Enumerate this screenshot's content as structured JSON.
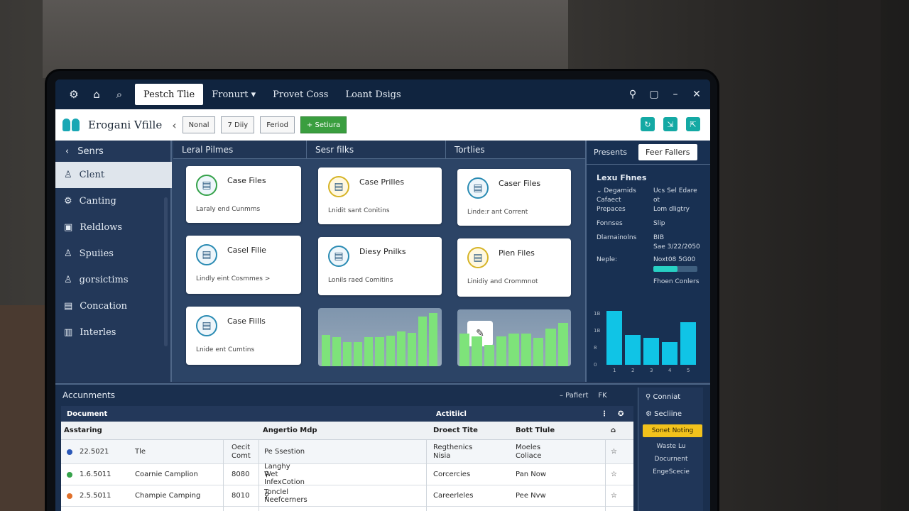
{
  "titlebar": {
    "tabs": [
      "Pestch Tlie",
      "Fronurt",
      "Provet Coss",
      "Loant Dsigs"
    ]
  },
  "header": {
    "app_name": "Erogani Vfille",
    "buttons": [
      "Nonal",
      "7 Diiy",
      "Feriod"
    ],
    "primary_button": "+ Setiura"
  },
  "sidebar": {
    "back_label": "Senrs",
    "items": [
      {
        "label": "Clent",
        "icon": "user-icon"
      },
      {
        "label": "Canting",
        "icon": "network-icon"
      },
      {
        "label": "Reldlows",
        "icon": "folder-icon"
      },
      {
        "label": "Spuiies",
        "icon": "person-icon"
      },
      {
        "label": "gorsictims",
        "icon": "person-icon"
      },
      {
        "label": "Concation",
        "icon": "building-icon"
      },
      {
        "label": "Interles",
        "icon": "document-icon"
      }
    ]
  },
  "main": {
    "columns": [
      "Leral Pilmes",
      "Sesr filks",
      "Tortlies"
    ],
    "cards": [
      {
        "title": "Case Files",
        "subtitle": "Laraly end Cunmms"
      },
      {
        "title": "Case Prilles",
        "subtitle": "Lnidit sant Conitins"
      },
      {
        "title": "Caser Files",
        "subtitle": "Linde:r ant Corrent"
      },
      {
        "title": "Casel Filie",
        "subtitle": "Lindly eint Cosmmes >"
      },
      {
        "title": "Diesy Pnilks",
        "subtitle": "Lonils raed Comitins"
      },
      {
        "title": "Pien Files",
        "subtitle": "Linidiy and Crommnot"
      },
      {
        "title": "Case Fiills",
        "subtitle": "Lnide ent Cumtins"
      }
    ],
    "chart_a": [
      0.56,
      0.52,
      0.44,
      0.44,
      0.52,
      0.52,
      0.55,
      0.63,
      0.6,
      0.9,
      0.96
    ],
    "chart_b": [
      0.6,
      0.55,
      0.4,
      0.55,
      0.6,
      0.6,
      0.52,
      0.7,
      0.8
    ]
  },
  "right_panel": {
    "tab_inactive": "Presents",
    "tab_active": "Feer Fallers",
    "title": "Lexu Fhnes",
    "rows": [
      {
        "key": "Degamids",
        "value": "Ucs Sel Edare"
      },
      {
        "key": "Cafaect",
        "value": "ot"
      },
      {
        "key": "Prepaces",
        "value": "Lom dligtry"
      },
      {
        "key": "Fonnses",
        "value": "Slip"
      },
      {
        "key": "Dlarnainolns",
        "value": "BIB"
      },
      {
        "key": "",
        "value": "Sae 3/22/2050"
      },
      {
        "key": "Neple:",
        "value": "Noxt08 5G00"
      }
    ],
    "progress": 0.55,
    "link": "Fhoen Conlers",
    "chart": {
      "type": "bar",
      "categories": [
        "1",
        "2",
        "3",
        "4",
        "5"
      ],
      "values": [
        0.95,
        0.53,
        0.47,
        0.4,
        0.75
      ],
      "y_ticks": [
        "1B",
        "1B",
        "8",
        "0"
      ]
    }
  },
  "documents": {
    "title": "Accunments",
    "controls": [
      "– Pafiert",
      "FK"
    ],
    "table_top": {
      "left": "Document",
      "mid": "Actitiicl"
    },
    "columns": [
      "Asstaring",
      "Angertio Mdp",
      "Droect Tite",
      "Bott Tlule"
    ],
    "rows": [
      {
        "dot": "#2a58b8",
        "date": "22.5021",
        "name": "Tle",
        "code": "Oecit Comt",
        "desc": "Pe Ssestion",
        "type": "Regthenics Nisia",
        "status": "Moeles Coliace"
      },
      {
        "dot": "#35a24a",
        "date": "1.6.5011",
        "name": "Coarnie Camplion",
        "code": "8080",
        "desc": "Langhy Wet InfexCotion",
        "type": "Corcercies",
        "status": "Pan Now"
      },
      {
        "dot": "#e0702a",
        "date": "2.5.5011",
        "name": "Champie Camping",
        "code": "8010",
        "desc": "Tonclel Neefcerners",
        "type": "Careerleles",
        "status": "Pee Nvw"
      }
    ],
    "side": {
      "contact": "Conniat",
      "settings": "Secliine",
      "button": "Sonet Noting",
      "lines": [
        "Waste Lu",
        "Docurnent",
        "EngeScecie"
      ]
    }
  }
}
